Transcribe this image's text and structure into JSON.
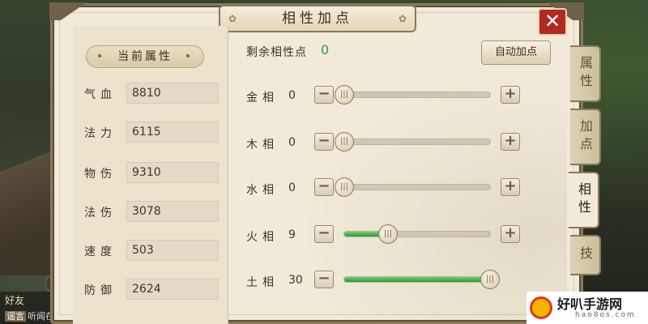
{
  "title": "相性加点",
  "left_panel": {
    "header": "当前属性",
    "attributes": [
      {
        "label": "气血",
        "value": "8810"
      },
      {
        "label": "法力",
        "value": "6115"
      },
      {
        "label": "物伤",
        "value": "9310"
      },
      {
        "label": "法伤",
        "value": "3078"
      },
      {
        "label": "速度",
        "value": "503"
      },
      {
        "label": "防御",
        "value": "2624"
      }
    ]
  },
  "remaining": {
    "label": "剩余相性点",
    "value": "0"
  },
  "auto_button": "自动加点",
  "affinities": [
    {
      "label": "金相",
      "value": "0",
      "level": 0.0,
      "has_plus": true
    },
    {
      "label": "木相",
      "value": "0",
      "level": 0.0,
      "has_plus": true
    },
    {
      "label": "水相",
      "value": "0",
      "level": 0.0,
      "has_plus": true
    },
    {
      "label": "火相",
      "value": "9",
      "level": 0.3,
      "has_plus": true
    },
    {
      "label": "土相",
      "value": "30",
      "level": 1.0,
      "has_plus": false
    }
  ],
  "stepper_minus": "−",
  "stepper_plus": "+",
  "knob_glyph": "|||",
  "close_glyph": "✕",
  "side_tabs": [
    {
      "label": "属性",
      "active": false
    },
    {
      "label": "加点",
      "active": false
    },
    {
      "label": "相性",
      "active": true
    },
    {
      "label": "技",
      "active": false
    }
  ],
  "chat": {
    "friends": "好友",
    "channel_tag": "谣言",
    "channel_text": "听闻在"
  },
  "watermark": {
    "title": "好叭手游网",
    "subtitle": "hao8os.com"
  },
  "colors": {
    "accent_green": "#2f9a3a",
    "close_red": "#b12a22"
  }
}
